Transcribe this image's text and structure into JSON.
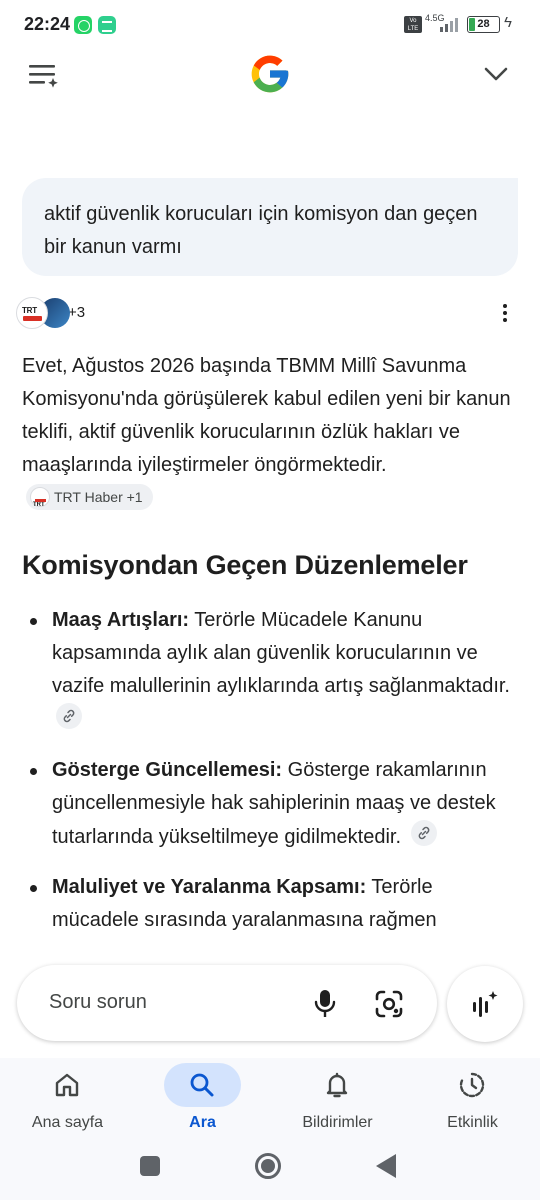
{
  "status_bar": {
    "time": "22:24",
    "network": "4.5G",
    "volte": "Vo LTE",
    "battery": "28",
    "icons": [
      "whatsapp-icon",
      "app-icon",
      "signal-icon",
      "battery-icon",
      "charging-icon"
    ]
  },
  "app_bar": {
    "menu_icon": "history-menu-icon",
    "logo": "google-g-logo",
    "account_icon": "chevron-down-icon"
  },
  "query": {
    "text": "aktif güvenlik korucuları için komisyon dan geçen bir kanun varmı"
  },
  "sources": {
    "count_label": "+3"
  },
  "answer": {
    "text": "Evet, Ağustos 2026 başında TBMM Millî Savunma Komisyonu'nda görüşülerek kabul edilen yeni bir kanun teklifi, aktif güvenlik korucularının özlük hakları ve maaşlarında iyileştirmeler öngörmektedir.",
    "chip_label": "TRT Haber +1",
    "chip_icon_text": "TRT",
    "section_title": "Komisyondan Geçen Düzenlemeler",
    "bullets": [
      {
        "title": "Maaş Artışları:",
        "text": " Terörle Mücadele Kanunu kapsamında aylık alan güvenlik korucularının ve vazife malullerinin aylıklarında artış sağlanmaktadır."
      },
      {
        "title": "Gösterge Güncellemesi:",
        "text": " Gösterge rakamlarının güncellenmesiyle hak sahiplerinin maaş ve destek tutarlarında yükseltilmeye gidilmektedir."
      },
      {
        "title": "Maluliyet ve Yaralanma Kapsamı:",
        "text": " Terörle mücadele sırasında yaralanmasına rağmen"
      }
    ]
  },
  "input": {
    "placeholder": "Soru sorun"
  },
  "bottom_nav": {
    "items": [
      {
        "label": "Ana sayfa",
        "icon": "home-icon",
        "active": false
      },
      {
        "label": "Ara",
        "icon": "search-icon",
        "active": true
      },
      {
        "label": "Bildirimler",
        "icon": "bell-icon",
        "active": false
      },
      {
        "label": "Etkinlik",
        "icon": "activity-icon",
        "active": false
      }
    ]
  },
  "colors": {
    "accent": "#0b57d0",
    "active_pill": "#d3e3fd",
    "query_bg": "#f0f4f9"
  }
}
